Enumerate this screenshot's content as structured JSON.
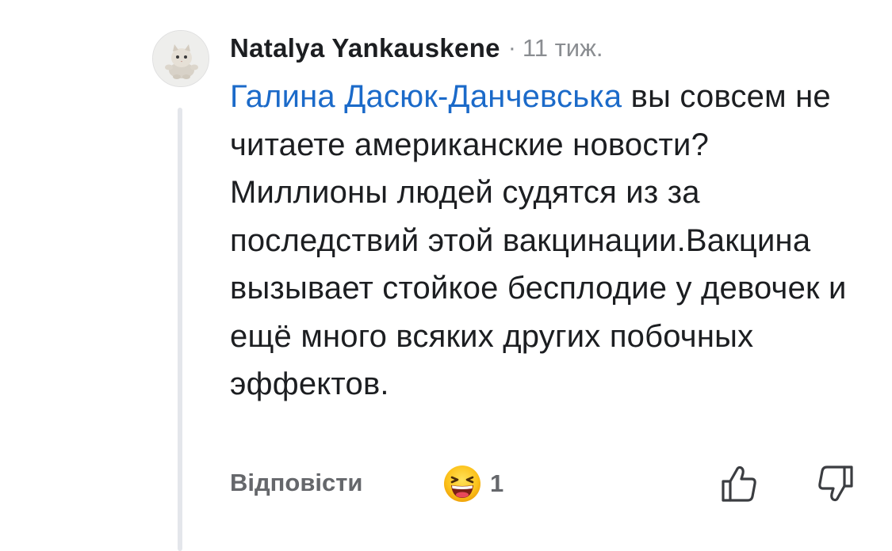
{
  "comment": {
    "author": "Natalya  Yankauskene",
    "separator": "·",
    "timestamp": "11 тиж.",
    "mention": "Галина Дасюк-Данчевська",
    "text": " вы совсем не читаете американские новости? Миллионы людей судятся из за последствий этой вакцинации.Вакцина вызывает стойкое бесплодие у девочек и ещё много всяких других побочных эффектов."
  },
  "actions": {
    "reply_label": "Відповісти",
    "reaction_icon": "grinning-face-emoji-icon",
    "reaction_count": "1",
    "like_icon": "thumbs-up-icon",
    "dislike_icon": "thumbs-down-icon"
  },
  "colors": {
    "mention": "#1b6ac9",
    "secondary_text": "#65676b",
    "timestamp": "#8a8d91",
    "thread_line": "#e4e6eb"
  }
}
